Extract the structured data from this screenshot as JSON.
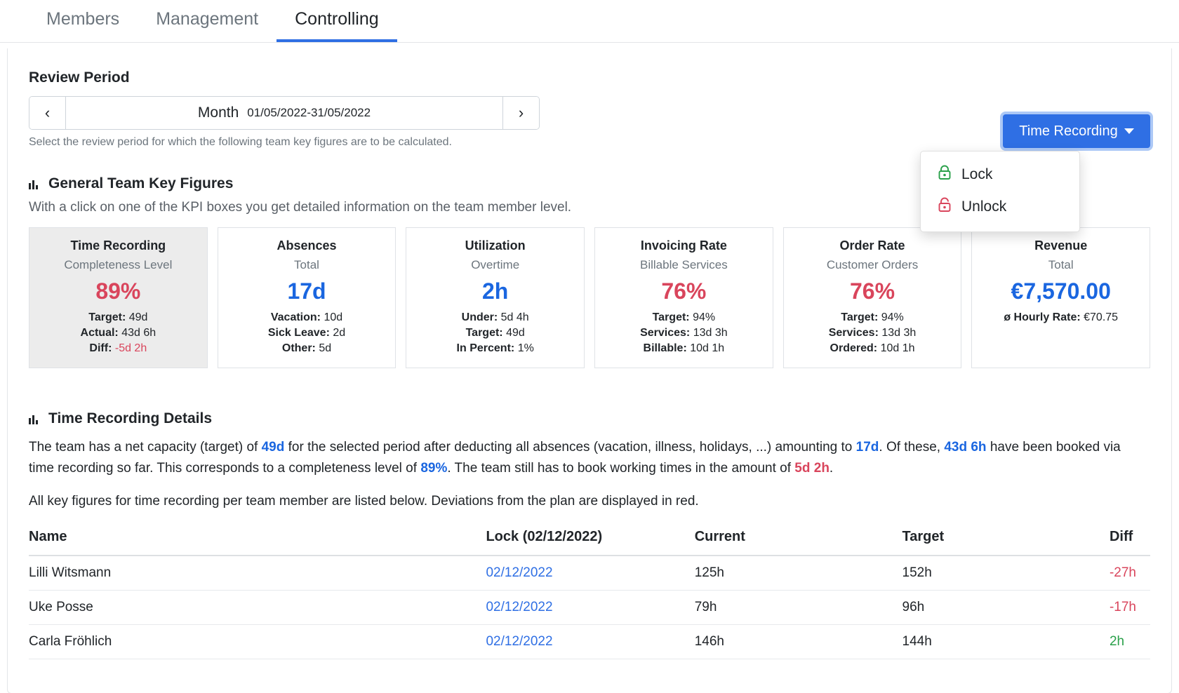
{
  "tabs": [
    {
      "label": "Members",
      "active": false
    },
    {
      "label": "Management",
      "active": false
    },
    {
      "label": "Controlling",
      "active": true
    }
  ],
  "review_period": {
    "title": "Review Period",
    "prev_label": "‹",
    "next_label": "›",
    "granularity": "Month",
    "range": "01/05/2022-31/05/2022",
    "hint": "Select the review period for which the following team key figures are to be calculated."
  },
  "time_recording_menu": {
    "button_label": "Time Recording",
    "caret_icon": "chevron-down-icon",
    "items": [
      {
        "label": "Lock",
        "icon": "lock-closed-icon",
        "color": "#2aa04a"
      },
      {
        "label": "Unlock",
        "icon": "lock-open-icon",
        "color": "#d9455c"
      }
    ]
  },
  "key_figures": {
    "icon": "bar-chart-icon",
    "heading": "General Team Key Figures",
    "subtext": "With a click on one of the KPI boxes you get detailed information on the team member level.",
    "boxes": [
      {
        "title": "Time Recording",
        "subtitle": "Completeness Level",
        "value": "89%",
        "value_color": "red",
        "selected": true,
        "lines": [
          {
            "label": "Target:",
            "value": "49d",
            "value_color": "normal"
          },
          {
            "label": "Actual:",
            "value": "43d 6h",
            "value_color": "normal"
          },
          {
            "label": "Diff:",
            "value": "-5d 2h",
            "value_color": "red"
          }
        ]
      },
      {
        "title": "Absences",
        "subtitle": "Total",
        "value": "17d",
        "value_color": "blue",
        "selected": false,
        "lines": [
          {
            "label": "Vacation:",
            "value": "10d",
            "value_color": "normal"
          },
          {
            "label": "Sick Leave:",
            "value": "2d",
            "value_color": "normal"
          },
          {
            "label": "Other:",
            "value": "5d",
            "value_color": "normal"
          }
        ]
      },
      {
        "title": "Utilization",
        "subtitle": "Overtime",
        "value": "2h",
        "value_color": "blue",
        "selected": false,
        "lines": [
          {
            "label": "Under:",
            "value": "5d 4h",
            "value_color": "normal"
          },
          {
            "label": "Target:",
            "value": "49d",
            "value_color": "normal"
          },
          {
            "label": "In Percent:",
            "value": "1%",
            "value_color": "normal"
          }
        ]
      },
      {
        "title": "Invoicing Rate",
        "subtitle": "Billable Services",
        "value": "76%",
        "value_color": "red",
        "selected": false,
        "lines": [
          {
            "label": "Target:",
            "value": "94%",
            "value_color": "normal"
          },
          {
            "label": "Services:",
            "value": "13d 3h",
            "value_color": "normal"
          },
          {
            "label": "Billable:",
            "value": "10d 1h",
            "value_color": "normal"
          }
        ]
      },
      {
        "title": "Order Rate",
        "subtitle": "Customer Orders",
        "value": "76%",
        "value_color": "red",
        "selected": false,
        "lines": [
          {
            "label": "Target:",
            "value": "94%",
            "value_color": "normal"
          },
          {
            "label": "Services:",
            "value": "13d 3h",
            "value_color": "normal"
          },
          {
            "label": "Ordered:",
            "value": "10d 1h",
            "value_color": "normal"
          }
        ]
      },
      {
        "title": "Revenue",
        "subtitle": "Total",
        "value": "€7,570.00",
        "value_color": "blue",
        "selected": false,
        "lines": [
          {
            "label": "ø Hourly Rate:",
            "value": "€70.75",
            "value_color": "normal"
          }
        ]
      }
    ]
  },
  "details": {
    "icon": "bar-chart-icon",
    "heading": "Time Recording Details",
    "paragraph": {
      "p1": "The team has a net capacity (target) of ",
      "v1": "49d",
      "p2": " for the selected period after deducting all absences (vacation, illness, holidays, ...) amounting to ",
      "v2": "17d",
      "p3": ". Of these, ",
      "v3": "43d 6h",
      "p4": " have been booked via time recording so far. This corresponds to a completeness level of ",
      "v4": "89%",
      "p5": ". The team still has to book working times in the amount of ",
      "v5": "5d 2h",
      "p6": "."
    },
    "paragraph2": "All key figures for time recording per team member are listed below. Deviations from the plan are displayed in red."
  },
  "table": {
    "headers": [
      "Name",
      "Lock (02/12/2022)",
      "Current",
      "Target",
      "Diff"
    ],
    "rows": [
      {
        "name": "Lilli Witsmann",
        "lock": "02/12/2022",
        "current": "125h",
        "target": "152h",
        "diff": "-27h",
        "diff_sign": "neg"
      },
      {
        "name": "Uke Posse",
        "lock": "02/12/2022",
        "current": "79h",
        "target": "96h",
        "diff": "-17h",
        "diff_sign": "neg"
      },
      {
        "name": "Carla Fröhlich",
        "lock": "02/12/2022",
        "current": "146h",
        "target": "144h",
        "diff": "2h",
        "diff_sign": "pos"
      }
    ]
  },
  "colors": {
    "accent": "#2f6fe4",
    "danger": "#d9455c",
    "success": "#2aa04a",
    "link": "#2f6fe4",
    "muted": "#6c757d"
  }
}
